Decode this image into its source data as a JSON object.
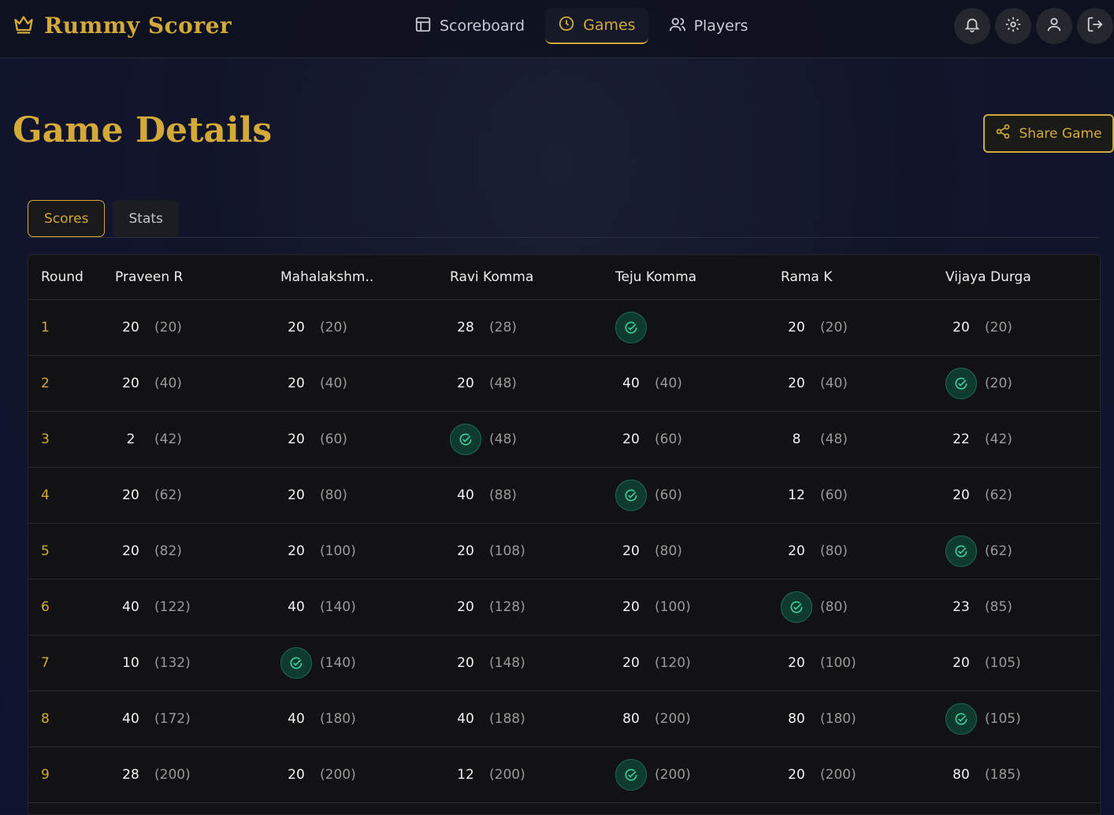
{
  "app": {
    "title": "Rummy Scorer"
  },
  "nav": {
    "items": [
      {
        "label": "Scoreboard",
        "icon": "layout-icon",
        "active": false
      },
      {
        "label": "Games",
        "icon": "clock-icon",
        "active": true
      },
      {
        "label": "Players",
        "icon": "users-icon",
        "active": false
      }
    ],
    "icon_buttons": [
      "bell-icon",
      "gear-icon",
      "user-icon",
      "logout-icon"
    ]
  },
  "page": {
    "title": "Game Details",
    "share_label": "Share Game"
  },
  "tabs": [
    {
      "label": "Scores",
      "active": true
    },
    {
      "label": "Stats",
      "active": false
    }
  ],
  "table": {
    "round_header": "Round",
    "players": [
      "Praveen R",
      "Mahalakshm..",
      "Ravi Komma",
      "Teju Komma",
      "Rama K",
      "Vijaya Durga"
    ],
    "rows": [
      {
        "round": "1",
        "cells": [
          {
            "score": "20",
            "total": "(20)"
          },
          {
            "score": "20",
            "total": "(20)"
          },
          {
            "score": "28",
            "total": "(28)"
          },
          {
            "win": true,
            "total": ""
          },
          {
            "score": "20",
            "total": "(20)"
          },
          {
            "score": "20",
            "total": "(20)"
          }
        ]
      },
      {
        "round": "2",
        "cells": [
          {
            "score": "20",
            "total": "(40)"
          },
          {
            "score": "20",
            "total": "(40)"
          },
          {
            "score": "20",
            "total": "(48)"
          },
          {
            "score": "40",
            "total": "(40)"
          },
          {
            "score": "20",
            "total": "(40)"
          },
          {
            "win": true,
            "total": "(20)"
          }
        ]
      },
      {
        "round": "3",
        "cells": [
          {
            "score": "2",
            "total": "(42)"
          },
          {
            "score": "20",
            "total": "(60)"
          },
          {
            "win": true,
            "total": "(48)"
          },
          {
            "score": "20",
            "total": "(60)"
          },
          {
            "score": "8",
            "total": "(48)"
          },
          {
            "score": "22",
            "total": "(42)"
          }
        ]
      },
      {
        "round": "4",
        "cells": [
          {
            "score": "20",
            "total": "(62)"
          },
          {
            "score": "20",
            "total": "(80)"
          },
          {
            "score": "40",
            "total": "(88)"
          },
          {
            "win": true,
            "total": "(60)"
          },
          {
            "score": "12",
            "total": "(60)"
          },
          {
            "score": "20",
            "total": "(62)"
          }
        ]
      },
      {
        "round": "5",
        "cells": [
          {
            "score": "20",
            "total": "(82)"
          },
          {
            "score": "20",
            "total": "(100)"
          },
          {
            "score": "20",
            "total": "(108)"
          },
          {
            "score": "20",
            "total": "(80)"
          },
          {
            "score": "20",
            "total": "(80)"
          },
          {
            "win": true,
            "total": "(62)"
          }
        ]
      },
      {
        "round": "6",
        "cells": [
          {
            "score": "40",
            "total": "(122)"
          },
          {
            "score": "40",
            "total": "(140)"
          },
          {
            "score": "20",
            "total": "(128)"
          },
          {
            "score": "20",
            "total": "(100)"
          },
          {
            "win": true,
            "total": "(80)"
          },
          {
            "score": "23",
            "total": "(85)"
          }
        ]
      },
      {
        "round": "7",
        "cells": [
          {
            "score": "10",
            "total": "(132)"
          },
          {
            "win": true,
            "total": "(140)"
          },
          {
            "score": "20",
            "total": "(148)"
          },
          {
            "score": "20",
            "total": "(120)"
          },
          {
            "score": "20",
            "total": "(100)"
          },
          {
            "score": "20",
            "total": "(105)"
          }
        ]
      },
      {
        "round": "8",
        "cells": [
          {
            "score": "40",
            "total": "(172)"
          },
          {
            "score": "40",
            "total": "(180)"
          },
          {
            "score": "40",
            "total": "(188)"
          },
          {
            "score": "80",
            "total": "(200)"
          },
          {
            "score": "80",
            "total": "(180)"
          },
          {
            "win": true,
            "total": "(105)"
          }
        ]
      },
      {
        "round": "9",
        "cells": [
          {
            "score": "28",
            "total": "(200)"
          },
          {
            "score": "20",
            "total": "(200)"
          },
          {
            "score": "12",
            "total": "(200)"
          },
          {
            "win": true,
            "total": "(200)"
          },
          {
            "score": "20",
            "total": "(200)"
          },
          {
            "score": "80",
            "total": "(185)"
          }
        ]
      }
    ]
  },
  "colors": {
    "accent": "#d4a93a",
    "win_bg": "#0f3a2e",
    "win_icon": "#3ecf9a"
  }
}
